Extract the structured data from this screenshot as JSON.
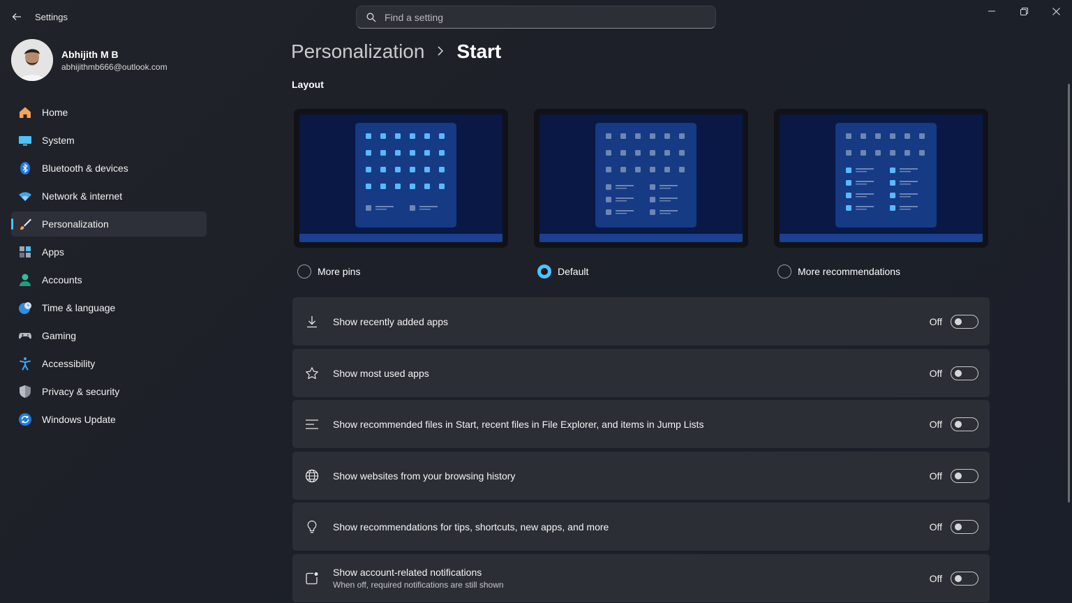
{
  "window": {
    "title": "Settings",
    "search_placeholder": "Find a setting"
  },
  "profile": {
    "name": "Abhijith M B",
    "email": "abhijithmb666@outlook.com"
  },
  "sidebar": {
    "items": [
      {
        "label": "Home",
        "icon": "home-icon"
      },
      {
        "label": "System",
        "icon": "monitor-icon"
      },
      {
        "label": "Bluetooth & devices",
        "icon": "bluetooth-icon"
      },
      {
        "label": "Network & internet",
        "icon": "wifi-icon"
      },
      {
        "label": "Personalization",
        "icon": "brush-icon",
        "active": true
      },
      {
        "label": "Apps",
        "icon": "apps-icon"
      },
      {
        "label": "Accounts",
        "icon": "person-icon"
      },
      {
        "label": "Time & language",
        "icon": "globe-clock-icon"
      },
      {
        "label": "Gaming",
        "icon": "controller-icon"
      },
      {
        "label": "Accessibility",
        "icon": "accessibility-icon"
      },
      {
        "label": "Privacy & security",
        "icon": "shield-icon"
      },
      {
        "label": "Windows Update",
        "icon": "update-icon"
      }
    ]
  },
  "main": {
    "breadcrumb_parent": "Personalization",
    "breadcrumb_current": "Start",
    "layout_title": "Layout",
    "layout_options": [
      {
        "label": "More pins",
        "selected": false
      },
      {
        "label": "Default",
        "selected": true
      },
      {
        "label": "More recommendations",
        "selected": false
      }
    ],
    "settings": [
      {
        "label": "Show recently added apps",
        "state": "Off",
        "icon": "download-icon"
      },
      {
        "label": "Show most used apps",
        "state": "Off",
        "icon": "star-icon"
      },
      {
        "label": "Show recommended files in Start, recent files in File Explorer, and items in Jump Lists",
        "state": "Off",
        "icon": "list-icon"
      },
      {
        "label": "Show websites from your browsing history",
        "state": "Off",
        "icon": "globe-icon"
      },
      {
        "label": "Show recommendations for tips, shortcuts, new apps, and more",
        "state": "Off",
        "icon": "lightbulb-icon"
      },
      {
        "label": "Show account-related notifications",
        "sublabel": "When off, required notifications are still shown",
        "state": "Off",
        "icon": "notification-icon"
      }
    ]
  },
  "colors": {
    "accent": "#4cc2ff",
    "background": "#202329",
    "card": "#2b2e35"
  }
}
